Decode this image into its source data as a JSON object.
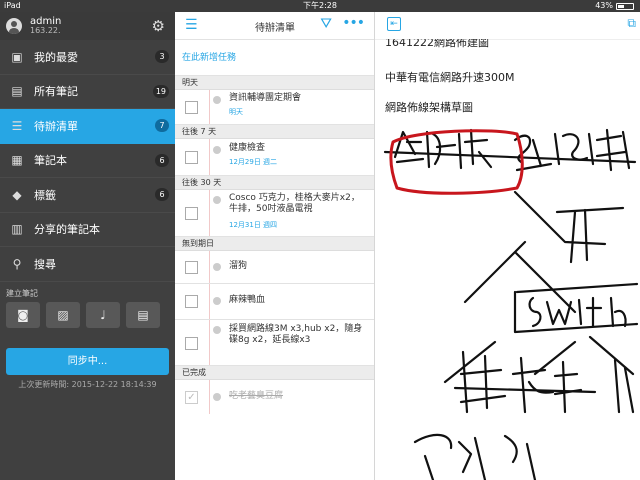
{
  "status_bar": {
    "device": "iPad",
    "time": "下午2:28",
    "battery": "43%",
    "battery_level": 0.43
  },
  "sidebar": {
    "account": {
      "name": "admin",
      "server": "163.22."
    },
    "items": [
      {
        "label": "我的最愛",
        "count": "3",
        "icon": "star-icon"
      },
      {
        "label": "所有筆記",
        "count": "19",
        "icon": "notes-icon"
      },
      {
        "label": "待辦清單",
        "count": "7",
        "icon": "todo-icon",
        "active": true
      },
      {
        "label": "筆記本",
        "count": "6",
        "icon": "notebook-icon"
      },
      {
        "label": "標籤",
        "count": "6",
        "icon": "tag-icon"
      },
      {
        "label": "分享的筆記本",
        "count": "",
        "icon": "shared-notebook-icon"
      },
      {
        "label": "搜尋",
        "count": "",
        "icon": "search-icon"
      }
    ],
    "create_label": "建立筆記",
    "sync_button": "同步中...",
    "last_sync": "上次更新時間: 2015-12-22 18:14:39"
  },
  "todo": {
    "title": "待辦清單",
    "add_task": "在此新增任務",
    "sections": {
      "tomorrow": "明天",
      "next7": "往後 7 天",
      "next30": "往後 30 天",
      "nodate": "無到期日",
      "done": "已完成"
    },
    "tasks": {
      "t1": {
        "title": "資訊輔導團定期會",
        "date": "明天"
      },
      "t2": {
        "title": "健康檢查",
        "date": "12月29日 週二"
      },
      "t3": {
        "title": "Cosco 巧克力，桂格大麥片x2，牛排，50吋液晶電視",
        "date": "12月31日 週四"
      },
      "t4": {
        "title": "溜狗",
        "date": ""
      },
      "t5": {
        "title": "麻辣鴨血",
        "date": ""
      },
      "t6": {
        "title": "採買網路線3M x3,hub x2，隨身碟8g x2，延長線x3",
        "date": ""
      },
      "t7": {
        "title": "吃老藝臭豆腐",
        "date": ""
      }
    }
  },
  "note": {
    "partial_top": "1641222網路佈建圖",
    "line1": "中華有電信網路升速300M",
    "line2": "網路佈線架構草圖"
  },
  "colors": {
    "accent": "#27a6e4",
    "sidebar_bg": "#404040",
    "ink": "#111111",
    "red_ink": "#c8161d"
  }
}
